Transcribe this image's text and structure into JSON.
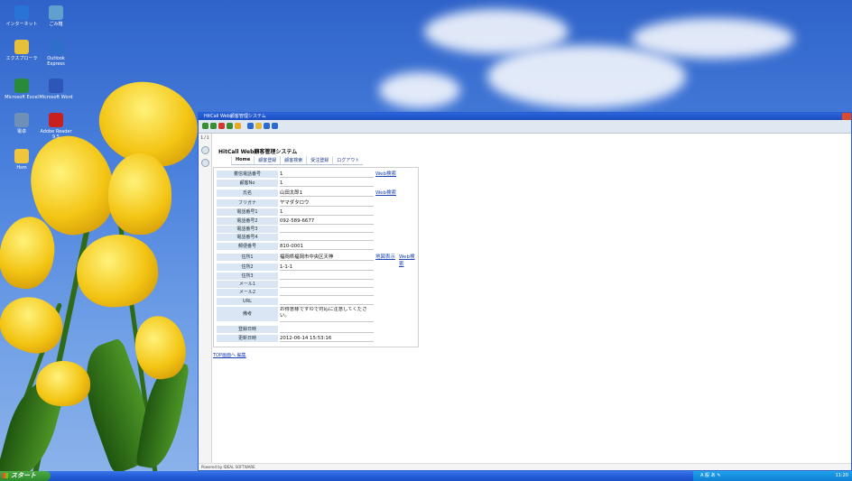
{
  "desktop_icons": [
    {
      "label": "インターネット",
      "icon": "internet-explorer-icon",
      "color": "#2a73d6"
    },
    {
      "label": "ごみ箱",
      "icon": "recycle-bin-icon",
      "color": "#5fa0cf"
    },
    {
      "label": "エクスプローラ",
      "icon": "explorer-icon",
      "color": "#e6c03a"
    },
    {
      "label": "Outlook Express",
      "icon": "outlook-express-icon",
      "color": "#2f6fc9"
    },
    {
      "label": "Microsoft Excel",
      "icon": "excel-icon",
      "color": "#2a8a3c"
    },
    {
      "label": "Microsoft Word",
      "icon": "word-icon",
      "color": "#2e55b8"
    },
    {
      "label": "電卓",
      "icon": "calculator-icon",
      "color": "#6d8fb8"
    },
    {
      "label": "Adobe Reader 9.5",
      "icon": "adobe-reader-icon",
      "color": "#c8201f"
    },
    {
      "label": "Hsm",
      "icon": "folder-icon",
      "color": "#f0c53e"
    }
  ],
  "window": {
    "title": "HitCall Web顧客管理システム",
    "app_title": "HitCall Web顧客管理システム",
    "side_label": "1 / 1"
  },
  "nav": [
    "Home",
    "顧客登録",
    "顧客検索",
    "受注登録",
    "ログアウト"
  ],
  "form": {
    "rows": [
      {
        "label": "着信電話番号",
        "value": "1",
        "link": "Web検索"
      },
      {
        "label": "顧客No",
        "value": "1",
        "link": ""
      },
      {
        "label": "氏名",
        "value": "山田太郎1",
        "link": "Web検索"
      },
      {
        "label": "フリガナ",
        "value": "ヤマダタロウ",
        "link": ""
      },
      {
        "label": "電話番号1",
        "value": "1",
        "link": ""
      },
      {
        "label": "電話番号2",
        "value": "092-589-6677",
        "link": ""
      },
      {
        "label": "電話番号3",
        "value": "",
        "link": ""
      },
      {
        "label": "電話番号4",
        "value": "",
        "link": ""
      },
      {
        "label": "郵便番号",
        "value": "810-0001",
        "link": ""
      },
      {
        "label": "住所1",
        "value": "福岡県福岡市中央区天神",
        "link": "地図表示",
        "link2": "Web検索"
      },
      {
        "label": "住所2",
        "value": "1-1-1",
        "link": ""
      },
      {
        "label": "住所3",
        "value": "",
        "link": ""
      },
      {
        "label": "メール1",
        "value": "",
        "link": ""
      },
      {
        "label": "メール2",
        "value": "",
        "link": ""
      },
      {
        "label": "URL",
        "value": "",
        "link": ""
      },
      {
        "label": "備考",
        "value": "お得意様ですので対応に注意してください。",
        "link": ""
      },
      {
        "label": "登録日時",
        "value": "",
        "link": ""
      },
      {
        "label": "更新日時",
        "value": "2012-06-14 15:53:16",
        "link": ""
      }
    ]
  },
  "bottom_links": "TOP画面へ 編集",
  "statusbar": "Powered by IDEAL SOFTWARE",
  "taskbar": {
    "start_label": "スタート",
    "tray_text": "A 般 あ ✎",
    "clock": "11:20"
  },
  "colors": {
    "accent": "#2a5fd0",
    "label_bg": "#dbe6f5",
    "link": "#1e45b5"
  }
}
